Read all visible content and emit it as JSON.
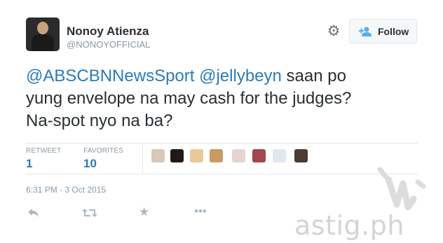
{
  "user": {
    "name": "Nonoy Atienza",
    "handle": "@NONOYOFFICIAL"
  },
  "header": {
    "settings_icon": "gear-icon",
    "follow_icon": "add-user-icon",
    "follow_label": "Follow"
  },
  "tweet": {
    "mention1": "@ABSCBNNewsSport",
    "mention2": "@jellybeyn",
    "text_line1": " saan po",
    "text_line2": "yung envelope na may cash for the judges?",
    "text_line3": "Na-spot nyo na ba?",
    "mention_color": "#2b7bb9"
  },
  "stats": {
    "retweet_label": "RETWEET",
    "retweet_count": "1",
    "favorites_label": "FAVORITES",
    "favorites_count": "10"
  },
  "favoriters": [
    {
      "color": "#d9c7b8"
    },
    {
      "color": "#1f1a17"
    },
    {
      "color": "#e8c99a"
    },
    {
      "color": "#c99a64"
    },
    {
      "color": "#e6d5cf"
    },
    {
      "color": "#a4464e"
    },
    {
      "color": "#dfe8ee"
    },
    {
      "color": "#4c3a35"
    }
  ],
  "timestamp": "6:31 PM - 3 Oct 2015",
  "actions": [
    {
      "icon": "reply-icon"
    },
    {
      "icon": "retweet-icon"
    },
    {
      "icon": "favorite-icon"
    },
    {
      "icon": "more-icon"
    }
  ],
  "watermark": {
    "text": "astig.ph"
  }
}
